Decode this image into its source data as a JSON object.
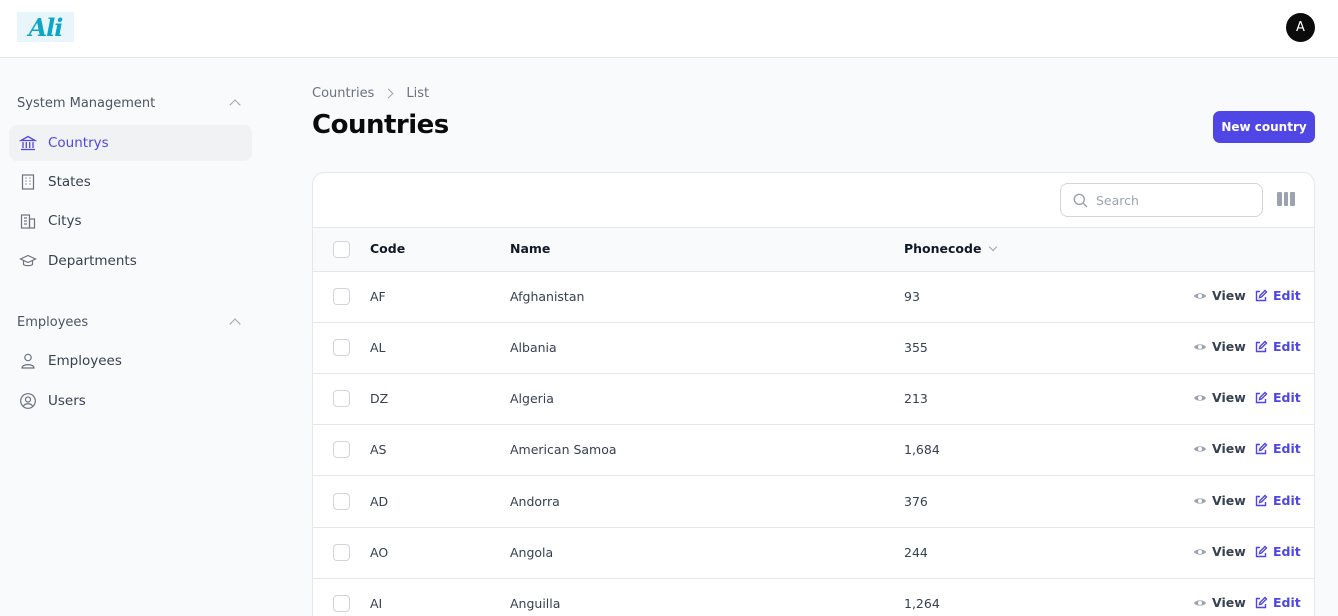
{
  "app": {
    "logo_text": "Ali",
    "avatar_initial": "A"
  },
  "sidebar": {
    "groups": [
      {
        "label": "System Management",
        "items": [
          {
            "label": "Countrys",
            "icon": "bank-icon",
            "active": true
          },
          {
            "label": "States",
            "icon": "building-icon",
            "active": false
          },
          {
            "label": "Citys",
            "icon": "office-building-icon",
            "active": false
          },
          {
            "label": "Departments",
            "icon": "graduation-cap-icon",
            "active": false
          }
        ]
      },
      {
        "label": "Employees",
        "items": [
          {
            "label": "Employees",
            "icon": "user-icon",
            "active": false
          },
          {
            "label": "Users",
            "icon": "user-circle-icon",
            "active": false
          }
        ]
      }
    ]
  },
  "breadcrumb": [
    "Countries",
    "List"
  ],
  "page": {
    "title": "Countries",
    "new_button": "New country"
  },
  "table": {
    "search_placeholder": "Search",
    "columns": [
      "Code",
      "Name",
      "Phonecode"
    ],
    "rows": [
      {
        "code": "AF",
        "name": "Afghanistan",
        "phonecode": "93"
      },
      {
        "code": "AL",
        "name": "Albania",
        "phonecode": "355"
      },
      {
        "code": "DZ",
        "name": "Algeria",
        "phonecode": "213"
      },
      {
        "code": "AS",
        "name": "American Samoa",
        "phonecode": "1,684"
      },
      {
        "code": "AD",
        "name": "Andorra",
        "phonecode": "376"
      },
      {
        "code": "AO",
        "name": "Angola",
        "phonecode": "244"
      },
      {
        "code": "AI",
        "name": "Anguilla",
        "phonecode": "1,264"
      }
    ],
    "view_label": "View",
    "edit_label": "Edit"
  },
  "colors": {
    "accent": "#4f46e5",
    "logo": "#0ea5c6"
  }
}
